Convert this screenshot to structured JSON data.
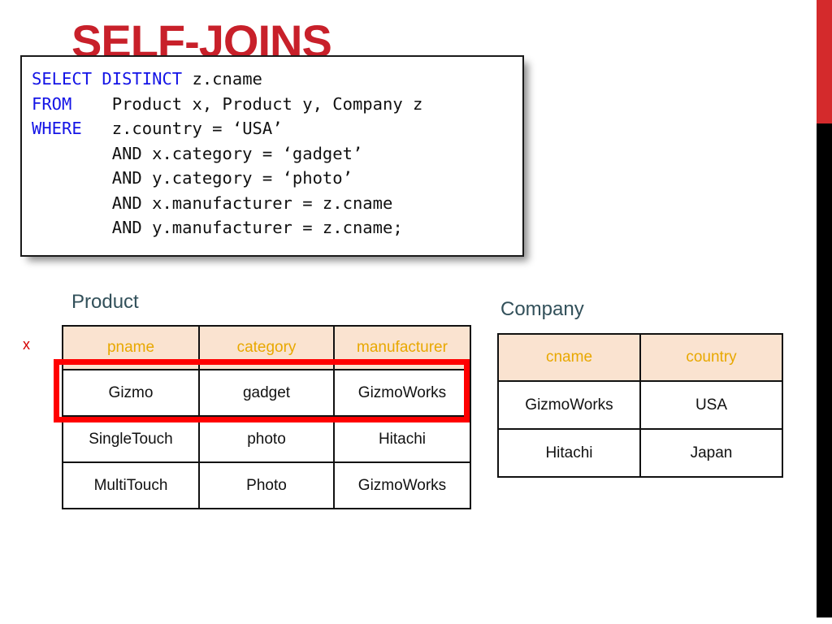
{
  "slide": {
    "title": "SELF-JOINS",
    "title_color": "#C8202A",
    "background": "#ffffff"
  },
  "decor": {
    "edge_bar_red_color": "#D42A2C",
    "edge_bar_black_color": "#000000"
  },
  "sql_box": {
    "keywords": [
      "SELECT",
      "DISTINCT",
      "FROM",
      "WHERE"
    ],
    "keyword_color": "#1414E6",
    "text_color": "#111111",
    "lines": [
      {
        "keyword": "SELECT DISTINCT",
        "rest": " z.cname"
      },
      {
        "keyword": "FROM",
        "rest": "    Product x, Product y, Company z"
      },
      {
        "keyword": "WHERE",
        "rest": "   z.country = ‘USA’"
      },
      {
        "keyword": "",
        "rest": "        AND x.category = ‘gadget’"
      },
      {
        "keyword": "",
        "rest": "        AND y.category = ‘photo’"
      },
      {
        "keyword": "",
        "rest": "        AND x.manufacturer = z.cname"
      },
      {
        "keyword": "",
        "rest": "        AND y.manufacturer = z.cname;"
      }
    ],
    "line1_kw": "SELECT DISTINCT",
    "line1_rest": " z.cname",
    "line2_kw": "FROM",
    "line2_rest": "    Product x, Product y, Company z",
    "line3_kw": "WHERE",
    "line3_rest": "   z.country = ‘USA’",
    "line4": "        AND x.category = ‘gadget’",
    "line5": "        AND y.category = ‘photo’",
    "line6": "        AND x.manufacturer = z.cname",
    "line7": "        AND y.manufacturer = z.cname;"
  },
  "product_table": {
    "caption": "Product",
    "caption_color": "#32505A",
    "header_bg": "#FAE3D0",
    "header_text_color": "#E8A800",
    "columns": [
      "pname",
      "category",
      "manufacturer"
    ],
    "rows": [
      [
        "Gizmo",
        "gadget",
        "GizmoWorks"
      ],
      [
        "SingleTouch",
        "photo",
        "Hitachi"
      ],
      [
        "MultiTouch",
        "Photo",
        "GizmoWorks"
      ]
    ],
    "highlight": {
      "row_index": 0,
      "color": "#FF0000"
    },
    "alias_label": "x",
    "alias_label_color": "#D40000"
  },
  "company_table": {
    "caption": "Company",
    "caption_color": "#32505A",
    "header_bg": "#FAE3D0",
    "header_text_color": "#E8A800",
    "columns": [
      "cname",
      "country"
    ],
    "rows": [
      [
        "GizmoWorks",
        "USA"
      ],
      [
        "Hitachi",
        "Japan"
      ]
    ]
  }
}
